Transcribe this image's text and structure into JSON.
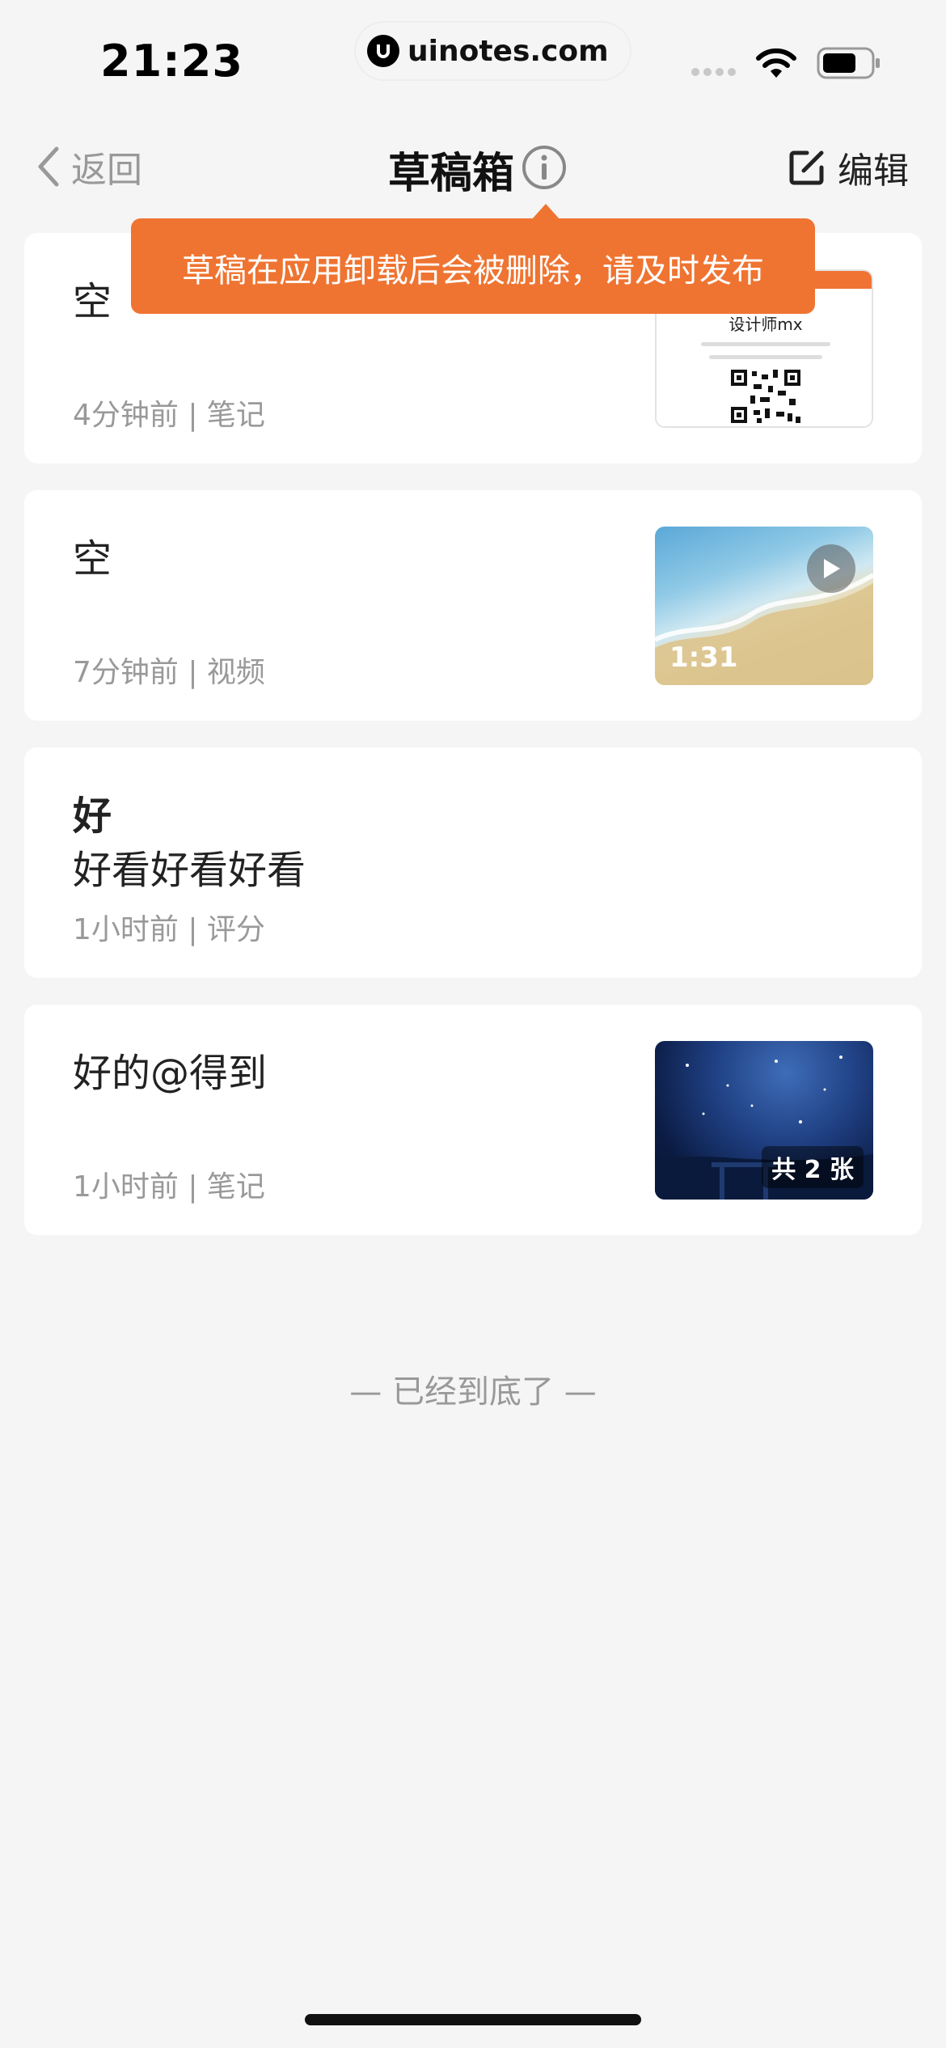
{
  "status_bar": {
    "time": "21:23",
    "watermark": "uinotes.com"
  },
  "nav": {
    "back_label": "返回",
    "title": "草稿箱",
    "edit_label": "编辑"
  },
  "tooltip": {
    "text": "草稿在应用卸载后会被删除，请及时发布"
  },
  "drafts": [
    {
      "title": "空",
      "meta": "4分钟前 | 笔记",
      "thumbnail": {
        "kind": "document",
        "heading": "设计师mx"
      }
    },
    {
      "title": "空",
      "meta": "7分钟前 | 视频",
      "thumbnail": {
        "kind": "video",
        "duration": "1:31",
        "icon": "play-icon"
      }
    },
    {
      "title": "好",
      "subtitle": "好看好看好看",
      "meta": "1小时前 | 评分"
    },
    {
      "title": "好的@得到",
      "meta": "1小时前 | 笔记",
      "thumbnail": {
        "kind": "image",
        "count_label": "共 2 张"
      }
    }
  ],
  "footer": {
    "end_text": "— 已经到底了 —"
  },
  "colors": {
    "accent": "#ef7431",
    "background": "#f5f5f5",
    "card": "#ffffff",
    "muted_text": "#999999"
  }
}
